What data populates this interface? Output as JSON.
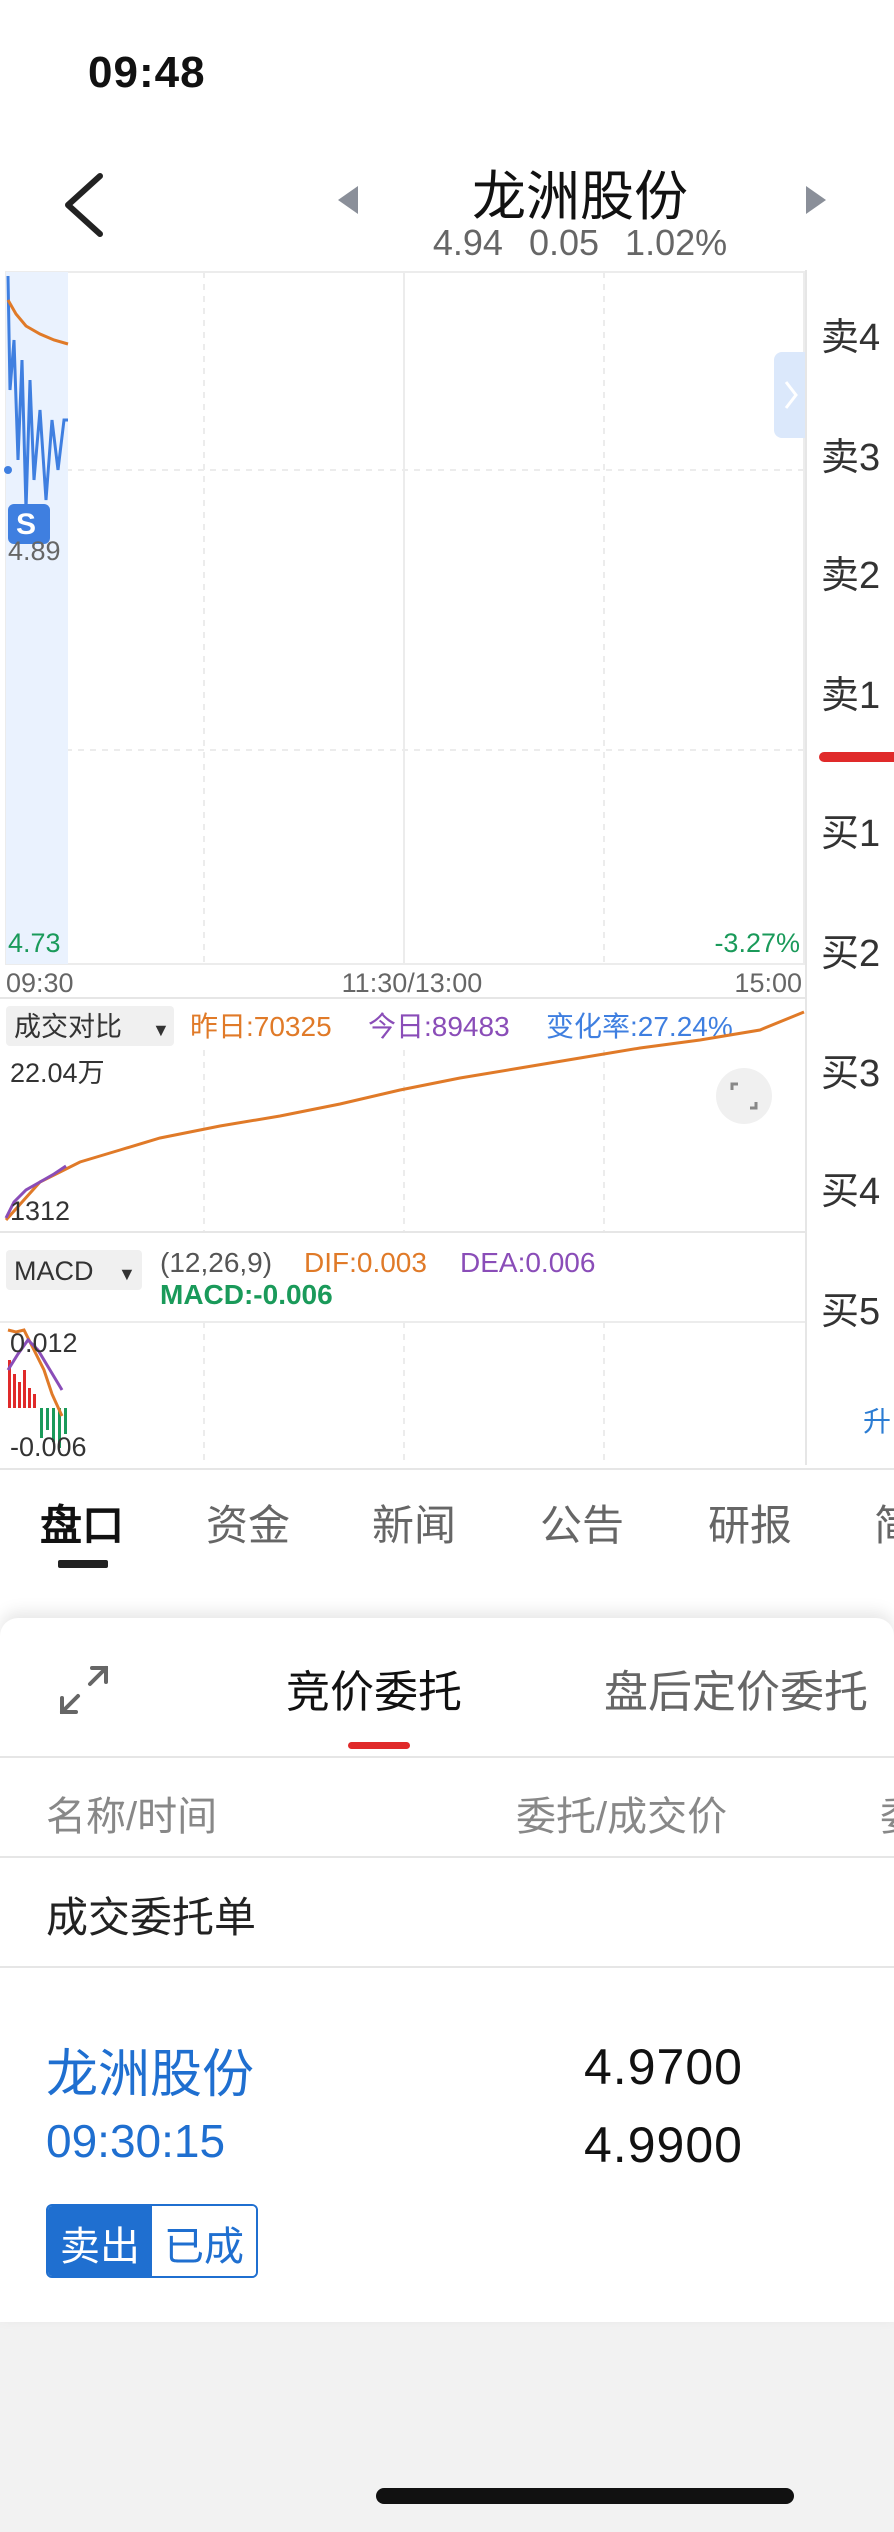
{
  "status_bar": {
    "time": "09:48"
  },
  "header": {
    "title": "龙洲股份",
    "price": "4.94",
    "change": "0.05",
    "change_pct": "1.02%"
  },
  "intraday": {
    "y_top_label": "4.89",
    "y_bottom_label": "4.73",
    "y_bottom_pct": "-3.27%",
    "x_labels": [
      "09:30",
      "11:30/13:00",
      "15:00"
    ],
    "marker": "S"
  },
  "volume_compare": {
    "selector_label": "成交对比",
    "yesterday": "昨日:70325",
    "today": "今日:89483",
    "change_rate": "变化率:27.24%",
    "y_top": "22.04万",
    "y_bottom": "1312"
  },
  "macd": {
    "selector_label": "MACD",
    "params": "(12,26,9)",
    "dif": "DIF:0.003",
    "dea": "DEA:0.006",
    "macd": "MACD:-0.006",
    "y_top": "0.012",
    "y_bottom": "-0.006"
  },
  "order_book_side": {
    "items": [
      "卖4",
      "卖3",
      "卖2",
      "卖1",
      "买1",
      "买2",
      "买3",
      "买4",
      "买5"
    ],
    "upgrade": "升"
  },
  "tabs": [
    "盘口",
    "资金",
    "新闻",
    "公告",
    "研报",
    "简"
  ],
  "sheet": {
    "tabs": [
      "竞价委托",
      "盘后定价委托"
    ],
    "columns": [
      "名称/时间",
      "委托/成交价",
      "委"
    ],
    "section_title": "成交委托单",
    "row": {
      "name": "龙洲股份",
      "time": "09:30:15",
      "price_order": "4.9700",
      "price_deal": "4.9900",
      "badge_side": "卖出",
      "badge_status": "已成"
    }
  },
  "colors": {
    "price_line": "#3f7fe0",
    "avg_line": "#e07a28",
    "today_line": "#8a4db8",
    "up_red": "#e02a2a",
    "down_green": "#1a9a5a",
    "accent_blue": "#1f6fd0"
  }
}
